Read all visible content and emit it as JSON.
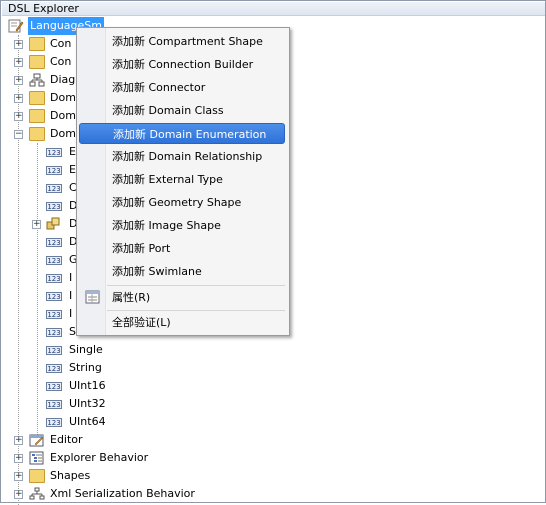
{
  "window": {
    "title": "DSL Explorer"
  },
  "tree": {
    "root_label": "LanguageSm",
    "items": {
      "conn1": "Con",
      "conn2": "Con",
      "diag": "Diag",
      "dom1": "Dom",
      "dom2": "Dom",
      "dom3": "Dom",
      "e1": "E",
      "e2": "E",
      "e3": "C",
      "e4": "D",
      "e5": "D",
      "e6": "D",
      "e7": "G",
      "e8": "I",
      "e9": "I",
      "e10": "I",
      "e11": "S",
      "single": "Single",
      "string": "String",
      "uint16": "UInt16",
      "uint32": "UInt32",
      "uint64": "UInt64",
      "editor": "Editor",
      "explorer_behavior": "Explorer Behavior",
      "shapes": "Shapes",
      "xml_behavior": "Xml Serialization Behavior"
    }
  },
  "context_menu": {
    "items": [
      "添加新 Compartment Shape",
      "添加新 Connection Builder",
      "添加新 Connector",
      "添加新 Domain Class",
      "添加新 Domain Enumeration",
      "添加新 Domain Relationship",
      "添加新 External Type",
      "添加新 Geometry Shape",
      "添加新 Image Shape",
      "添加新 Port",
      "添加新 Swimlane"
    ],
    "properties": "属性(R)",
    "validate_all": "全部验证(L)",
    "highlighted_index": 4
  },
  "icons": {
    "root": "dsl-pencil-icon",
    "folder": "folder-icon",
    "diagram": "diagram-icon",
    "enum_value": "numeric-123-icon",
    "properties": "properties-icon",
    "editor": "editor-icon",
    "explorer": "explorer-behavior-icon",
    "xml": "xml-serialization-icon"
  },
  "colors": {
    "highlight": "#3399ff",
    "menu_highlight": "#2f72d9",
    "folder": "#f4d470"
  }
}
